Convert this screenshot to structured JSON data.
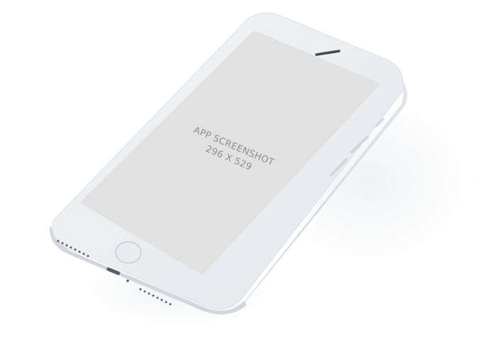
{
  "mockup": {
    "caption_line1": "APP SCREENSHOT",
    "caption_line2": "296 X 529"
  },
  "colors": {
    "background": "#ffffff",
    "phone_body": "#ebedf0",
    "phone_edge": "#d8dbe1",
    "screen": "#e1e1e1",
    "caption_text": "#8f8f8f",
    "speaker_grille": "#5a5d66"
  },
  "icons": {
    "home_button": "home-button-icon",
    "earpiece": "earpiece-icon",
    "lightning_port": "lightning-port-icon"
  }
}
